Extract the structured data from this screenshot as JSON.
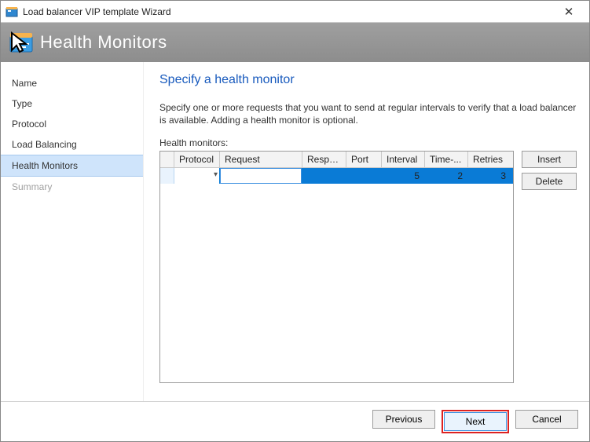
{
  "window": {
    "title": "Load balancer VIP template Wizard",
    "close": "✕"
  },
  "banner": {
    "title": "Health Monitors"
  },
  "sidebar": {
    "items": [
      {
        "label": "Name"
      },
      {
        "label": "Type"
      },
      {
        "label": "Protocol"
      },
      {
        "label": "Load Balancing"
      },
      {
        "label": "Health Monitors",
        "active": true
      },
      {
        "label": "Summary",
        "disabled": true
      }
    ]
  },
  "main": {
    "heading": "Specify a health monitor",
    "description": "Specify one or more requests that you want to send at regular intervals to verify that a load balancer is available. Adding a health monitor is optional.",
    "grid_label": "Health monitors:",
    "columns": {
      "protocol": "Protocol",
      "request": "Request",
      "response": "Respo...",
      "port": "Port",
      "interval": "Interval",
      "timeout": "Time-...",
      "retries": "Retries"
    },
    "row": {
      "protocol": "",
      "request": "",
      "response": "",
      "port": "",
      "interval": "5",
      "timeout": "2",
      "retries": "3"
    },
    "buttons": {
      "insert": "Insert",
      "delete": "Delete"
    }
  },
  "footer": {
    "previous": "Previous",
    "next": "Next",
    "cancel": "Cancel"
  }
}
